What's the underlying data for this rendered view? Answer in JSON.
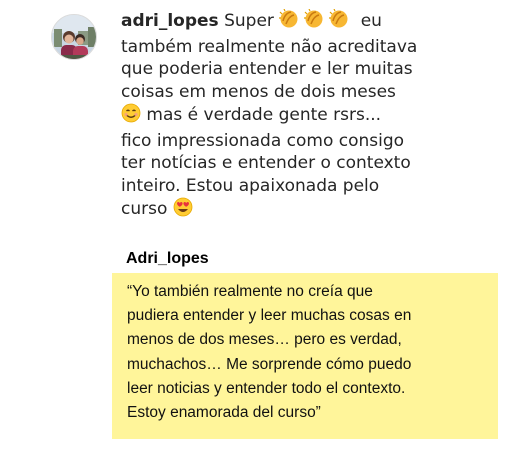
{
  "comment": {
    "username": "adri_lopes",
    "avatar_icon": "profile-photo",
    "line1_text": "Super",
    "line1_end": "eu",
    "line1_emoji": "clapping-hands-icon",
    "line2": "também realmente não acreditava",
    "line3": "que poderia entender e ler muitas",
    "line4": "coisas em menos de dois meses",
    "line5_emoji": "smiling-face-icon",
    "line5": "mas é verdade gente rsrs...",
    "line6": "fico impressionada como consigo",
    "line7": "ter notícias e entender o contexto",
    "line8": "inteiro. Estou apaixonada pelo",
    "line9": "curso",
    "line9_emoji": "heart-eyes-icon"
  },
  "translation": {
    "username": "Adri_lopes",
    "highlight_color": "#fff59a",
    "lines": [
      "“Yo también realmente no creía que",
      "pudiera entender y leer muchas cosas en",
      "menos de dos meses… pero es verdad,",
      "muchachos… Me sorprende cómo puedo",
      "leer noticias y entender todo el contexto.",
      "Estoy enamorada del curso”"
    ]
  }
}
